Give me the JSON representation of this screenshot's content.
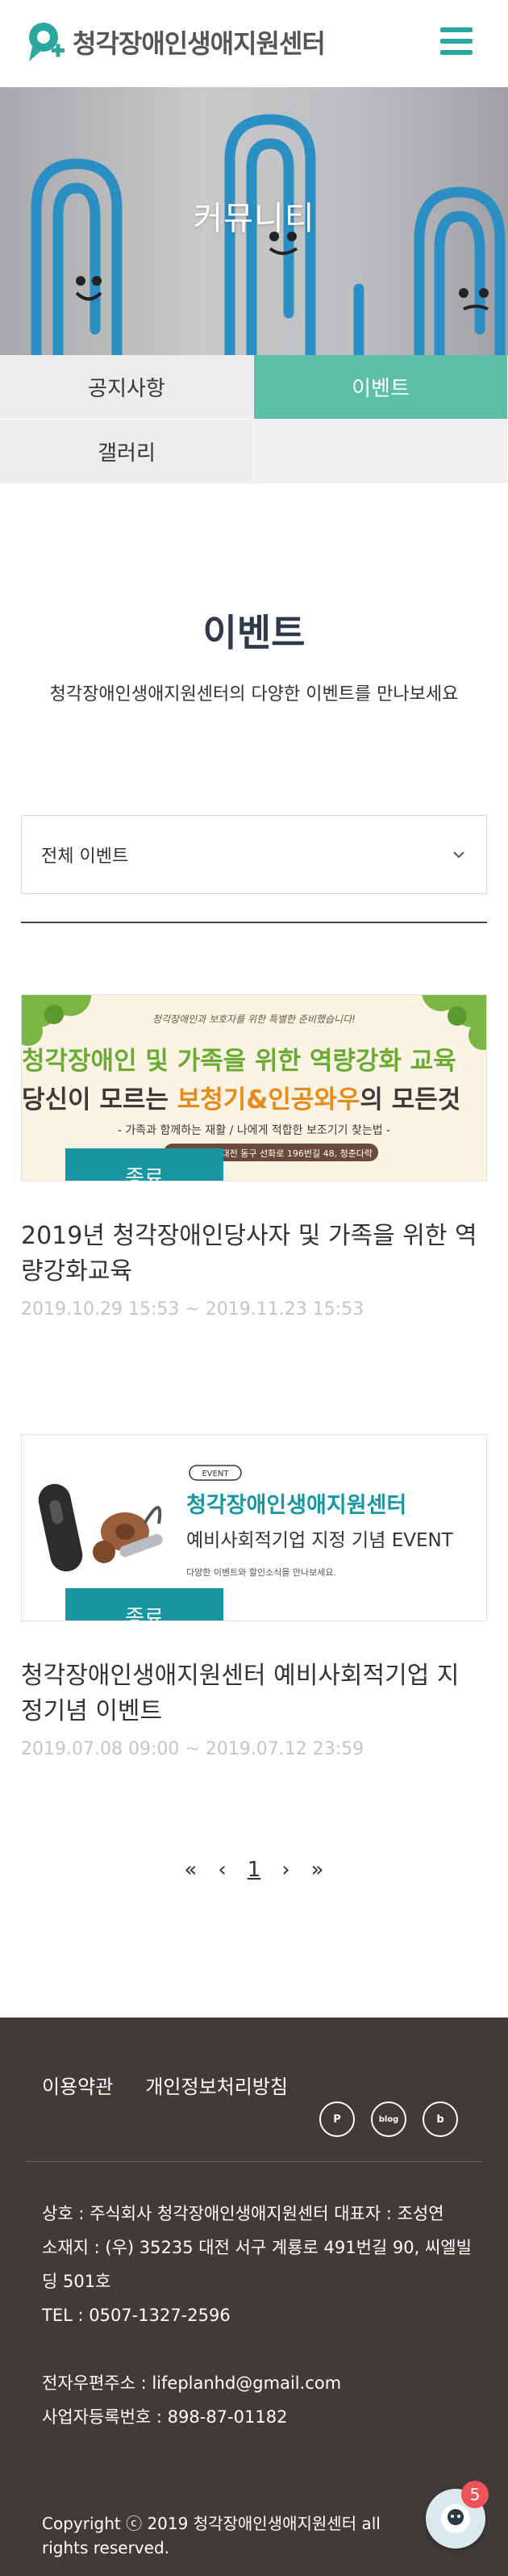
{
  "header": {
    "logo_text": "청각장애인생애지원센터",
    "menu_icon": "hamburger-icon",
    "brand_color": "#2aa8a0"
  },
  "hero": {
    "title": "커뮤니티"
  },
  "tabs": [
    {
      "label": "공지사항",
      "active": false
    },
    {
      "label": "이벤트",
      "active": true
    },
    {
      "label": "갤러리",
      "active": false
    }
  ],
  "section": {
    "title": "이벤트",
    "subtitle": "청각장애인생애지원센터의 다양한 이벤트를 만나보세요"
  },
  "filter": {
    "selected": "전체 이벤트",
    "icon": "chevron-down-icon"
  },
  "events": [
    {
      "status": "종료",
      "title": "2019년 청각장애인당사자 및 가족을 위한 역량강화교육",
      "date": "2019.10.29 15:53 ~ 2019.11.23 15:53",
      "thumb": {
        "line1": "청각장애인 및 가족을 위한 역량강화 교육",
        "line2a": "당신이 모르는 ",
        "line2b": "보청기&인공와우",
        "line2c": "의 모든것",
        "line3": "- 가족과 함께하는 재활 / 나에게 적합한 보조기기 찾는법 -",
        "line4": "(토) 13:00 / 대전 동구 선화로 196번길 48, 청춘다락"
      }
    },
    {
      "status": "종료",
      "title": "청각장애인생애지원센터 예비사회적기업 지정기념 이벤트",
      "date": "2019.07.08 09:00 ~ 2019.07.12 23:59",
      "thumb": {
        "tag": "EVENT",
        "line1": "청각장애인생애지원센터",
        "line2": "예비사회적기업 지정 기념 EVENT",
        "line3": "다양한 이벤트와 할인소식을 만나보세요."
      }
    }
  ],
  "pagination": {
    "first": "«",
    "prev": "‹",
    "current": "1",
    "next": "›",
    "last": "»"
  },
  "footer": {
    "links": [
      "이용약관",
      "개인정보처리방침"
    ],
    "social_icons": [
      "post-icon",
      "blog-icon",
      "band-icon"
    ],
    "info": {
      "company": "상호 : 주식회사 청각장애인생애지원센터    대표자 : 조성연",
      "address": "소재지 : (우) 35235 대전 서구 계룡로 491번길 90, 씨엘빌딩 501호",
      "tel": "TEL : 0507-1327-2596",
      "email": "전자우편주소 : lifeplanhd@gmail.com",
      "biz_no": "사업자등록번호 : 898-87-01182"
    },
    "copyright": "Copyright ⓒ 2019 청각장애인생애지원센터 all rights reserved."
  },
  "chat": {
    "badge_count": "5"
  }
}
